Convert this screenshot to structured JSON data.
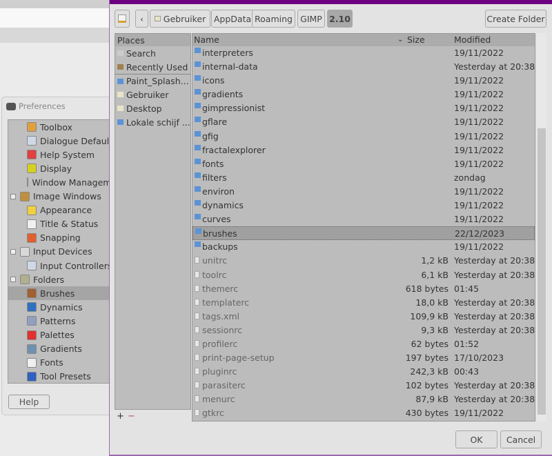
{
  "preferences": {
    "title": "Preferences",
    "help_label": "Help",
    "tree": [
      {
        "label": "Toolbox",
        "level": 1,
        "icon": "toolbox-icon",
        "color": "#e0a040"
      },
      {
        "label": "Dialogue Defaults",
        "level": 1,
        "icon": "dialogue-defaults-icon",
        "color": "#d0d8e8"
      },
      {
        "label": "Help System",
        "level": 1,
        "icon": "lifebuoy-icon",
        "color": "#e04040"
      },
      {
        "label": "Display",
        "level": 1,
        "icon": "display-icon",
        "color": "#d8d020"
      },
      {
        "label": "Window Management",
        "level": 1,
        "icon": "window-icon",
        "color": "#f0f0f0"
      },
      {
        "label": "Image Windows",
        "level": 0,
        "icon": "image-windows-icon",
        "color": "#c09040"
      },
      {
        "label": "Appearance",
        "level": 1,
        "icon": "appearance-icon",
        "color": "#f0d040"
      },
      {
        "label": "Title & Status",
        "level": 1,
        "icon": "title-status-icon",
        "color": "#f0f0f0"
      },
      {
        "label": "Snapping",
        "level": 1,
        "icon": "magnet-icon",
        "color": "#e06030"
      },
      {
        "label": "Input Devices",
        "level": 0,
        "icon": "input-devices-icon",
        "color": "#d8d8d8"
      },
      {
        "label": "Input Controllers",
        "level": 1,
        "icon": "input-controllers-icon",
        "color": "#d0d8e8"
      },
      {
        "label": "Folders",
        "level": 0,
        "icon": "folders-icon",
        "color": "#b0b090"
      },
      {
        "label": "Brushes",
        "level": 1,
        "icon": "brush-icon",
        "color": "#a06030",
        "selected": true
      },
      {
        "label": "Dynamics",
        "level": 1,
        "icon": "dynamics-icon",
        "color": "#3070c0"
      },
      {
        "label": "Patterns",
        "level": 1,
        "icon": "patterns-icon",
        "color": "#90a0c0"
      },
      {
        "label": "Palettes",
        "level": 1,
        "icon": "palettes-icon",
        "color": "#e03030"
      },
      {
        "label": "Gradients",
        "level": 1,
        "icon": "gradients-icon",
        "color": "#7090b0"
      },
      {
        "label": "Fonts",
        "level": 1,
        "icon": "fonts-icon",
        "color": "#f0f0f0"
      },
      {
        "label": "Tool Presets",
        "level": 1,
        "icon": "tool-presets-icon",
        "color": "#3060c0"
      }
    ]
  },
  "dialog": {
    "breadcrumbs": [
      "Gebruiker",
      "AppData",
      "Roaming",
      "GIMP",
      "2.10"
    ],
    "create_folder_label": "Create Folder",
    "ok_label": "OK",
    "cancel_label": "Cancel",
    "places_header": "Places",
    "places": [
      {
        "label": "Search",
        "icon": "search-icon"
      },
      {
        "label": "Recently Used",
        "icon": "recent-icon"
      },
      {
        "label": "Paint_Splash...",
        "icon": "folder-icon"
      },
      {
        "label": "Gebruiker",
        "icon": "home-folder-icon"
      },
      {
        "label": "Desktop",
        "icon": "desktop-folder-icon"
      },
      {
        "label": "Lokale schijf ...",
        "icon": "drive-icon"
      }
    ],
    "add_label": "+",
    "remove_label": "−",
    "columns": {
      "name": "Name",
      "size": "Size",
      "modified": "Modified"
    },
    "files": [
      {
        "name": "interpreters",
        "size": "",
        "modified": "19/11/2022",
        "type": "folder"
      },
      {
        "name": "internal-data",
        "size": "",
        "modified": "Yesterday at 20:38",
        "type": "folder"
      },
      {
        "name": "icons",
        "size": "",
        "modified": "19/11/2022",
        "type": "folder"
      },
      {
        "name": "gradients",
        "size": "",
        "modified": "19/11/2022",
        "type": "folder"
      },
      {
        "name": "gimpressionist",
        "size": "",
        "modified": "19/11/2022",
        "type": "folder"
      },
      {
        "name": "gflare",
        "size": "",
        "modified": "19/11/2022",
        "type": "folder"
      },
      {
        "name": "gfig",
        "size": "",
        "modified": "19/11/2022",
        "type": "folder"
      },
      {
        "name": "fractalexplorer",
        "size": "",
        "modified": "19/11/2022",
        "type": "folder"
      },
      {
        "name": "fonts",
        "size": "",
        "modified": "19/11/2022",
        "type": "folder"
      },
      {
        "name": "filters",
        "size": "",
        "modified": "zondag",
        "type": "folder"
      },
      {
        "name": "environ",
        "size": "",
        "modified": "19/11/2022",
        "type": "folder"
      },
      {
        "name": "dynamics",
        "size": "",
        "modified": "19/11/2022",
        "type": "folder"
      },
      {
        "name": "curves",
        "size": "",
        "modified": "19/11/2022",
        "type": "folder"
      },
      {
        "name": "brushes",
        "size": "",
        "modified": "22/12/2023",
        "type": "folder",
        "selected": true
      },
      {
        "name": "backups",
        "size": "",
        "modified": "19/11/2022",
        "type": "folder"
      },
      {
        "name": "unitrc",
        "size": "1,2 kB",
        "modified": "Yesterday at 20:38",
        "type": "file"
      },
      {
        "name": "toolrc",
        "size": "6,1 kB",
        "modified": "Yesterday at 20:38",
        "type": "file"
      },
      {
        "name": "themerc",
        "size": "618 bytes",
        "modified": "01:45",
        "type": "file"
      },
      {
        "name": "templaterc",
        "size": "18,0 kB",
        "modified": "Yesterday at 20:38",
        "type": "file"
      },
      {
        "name": "tags.xml",
        "size": "109,9 kB",
        "modified": "Yesterday at 20:38",
        "type": "file"
      },
      {
        "name": "sessionrc",
        "size": "9,3 kB",
        "modified": "Yesterday at 20:38",
        "type": "file"
      },
      {
        "name": "profilerc",
        "size": "62 bytes",
        "modified": "01:52",
        "type": "file"
      },
      {
        "name": "print-page-setup",
        "size": "197 bytes",
        "modified": "17/10/2023",
        "type": "file"
      },
      {
        "name": "pluginrc",
        "size": "242,3 kB",
        "modified": "00:43",
        "type": "file"
      },
      {
        "name": "parasiterc",
        "size": "102 bytes",
        "modified": "Yesterday at 20:38",
        "type": "file"
      },
      {
        "name": "menurc",
        "size": "87,9 kB",
        "modified": "Yesterday at 20:38",
        "type": "file"
      },
      {
        "name": "gtkrc",
        "size": "430 bytes",
        "modified": "19/11/2022",
        "type": "file"
      }
    ]
  }
}
